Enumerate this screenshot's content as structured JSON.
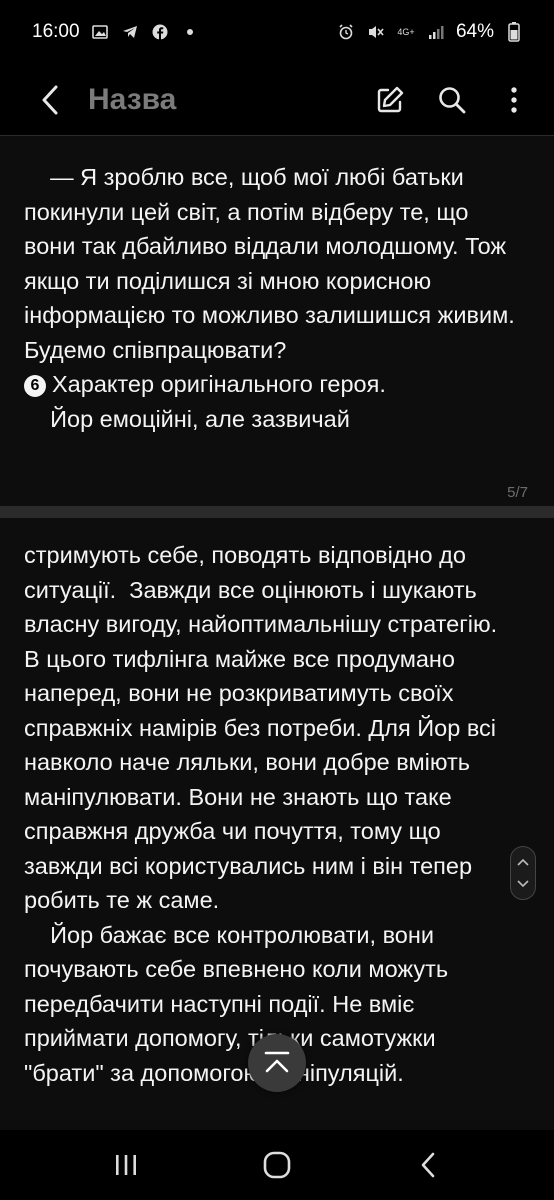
{
  "status": {
    "time": "16:00",
    "network": "4G+",
    "battery": "64%"
  },
  "appbar": {
    "title": "Назва"
  },
  "pages": {
    "first": {
      "para1": "    — Я зроблю все, щоб мої любі батьки покинули цей світ, а потім відберу те, що вони так дбайливо віддали молодшому. Тож якщо ти поділишся зі мною корисною інформацією то можливо залишишся живим. Будемо співпрацювати?",
      "bullet_number": "6",
      "heading": "Характер оригінального героя.",
      "para2": "    Йор емоційні, але зазвичай",
      "page_indicator": "5/7"
    },
    "second": {
      "para1": "стримують себе, поводять відповідно до ситуації.  Завжди все оцінюють і шукають власну вигоду, найоптимальнішу стратегію. В цього тифлінга майже все продумано наперед, вони не розкриватимуть своїх справжніх намірів без потреби. Для Йор всі навколо наче ляльки, вони добре вміють маніпулювати. Вони не знають що таке справжня дружба чи почуття, тому що завжди всі користувались ним і він тепер робить те ж саме.",
      "para2": "    Йор бажає все контролювати, вони почувають себе впевнено коли можуть передбачити наступні події. Не вміє приймати допомогу, тільки самотужки \"брати\" за допомогою маніпуляцій."
    }
  },
  "colors": {
    "background": "#000000",
    "page": "#0d0d0d",
    "title_gray": "#7b7b7b"
  },
  "icons": {
    "back": "chevron-left-icon",
    "edit": "edit-icon",
    "search": "search-icon",
    "more": "more-vertical-icon",
    "scroll_to_top": "arrow-up-bar-icon"
  }
}
